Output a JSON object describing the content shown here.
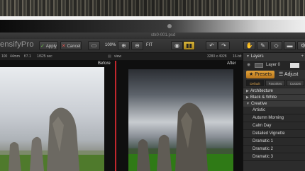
{
  "window": {
    "title": "stk0-001.psd",
    "brand": "ensifyPro"
  },
  "toolbar": {
    "apply_label": "Apply",
    "cancel_label": "Cancel",
    "zoom_percent": "100%",
    "fit_label": "FIT"
  },
  "infobar": {
    "iso": "100",
    "focal": "44mm",
    "aperture": "f/7.1",
    "shutter": "1/625 sec",
    "view_label": "view",
    "dimensions": "3280 x 4928",
    "bit_depth": "16-bit"
  },
  "canvas": {
    "before_label": "Before",
    "after_label": "After"
  },
  "panel": {
    "layers_title": "Layers",
    "layer_name": "Layer 0",
    "presets_tab": "Presets",
    "adjust_tab": "Adjust",
    "subtabs": [
      "Default",
      "Favorites",
      "Custom"
    ],
    "categories": [
      "Architecture",
      "Black & White",
      "Creative"
    ],
    "presets": [
      "Artistic",
      "Autumn Morning",
      "Calm Day",
      "Detailed Vignette",
      "Dramatic 1",
      "Dramatic 2",
      "Dramatic 3"
    ]
  },
  "colors": {
    "accent": "#e1a23a",
    "divider": "#c1272d",
    "apply_check": "#6bc24a",
    "cancel_x": "#d9534f"
  }
}
